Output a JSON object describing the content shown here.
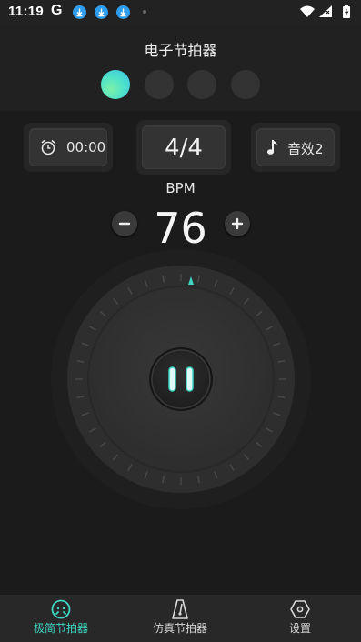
{
  "status": {
    "time": "11:19",
    "g_label": "G"
  },
  "header": {
    "title": "电子节拍器",
    "pages_count": 4,
    "active_page": 1
  },
  "controls": {
    "timer": {
      "icon": "alarm-clock-icon",
      "value": "00:00"
    },
    "time_signature": "4/4",
    "sound": {
      "icon": "music-note-icon",
      "label": "音效2"
    }
  },
  "tempo": {
    "label": "BPM",
    "value": "76",
    "minus_icon": "minus-icon",
    "plus_icon": "plus-icon"
  },
  "dial": {
    "state": "playing",
    "center_icon": "pause-icon",
    "accent_color": "#3fd6c5"
  },
  "nav": {
    "items": [
      {
        "label": "极简节拍器",
        "icon": "metronome-face-icon",
        "active": true
      },
      {
        "label": "仿真节拍器",
        "icon": "metronome-icon",
        "active": false
      },
      {
        "label": "设置",
        "icon": "hexagon-settings-icon",
        "active": false
      }
    ]
  },
  "colors": {
    "accent": "#3fd6c5",
    "background": "#1b1b1b",
    "panel": "#262626"
  }
}
